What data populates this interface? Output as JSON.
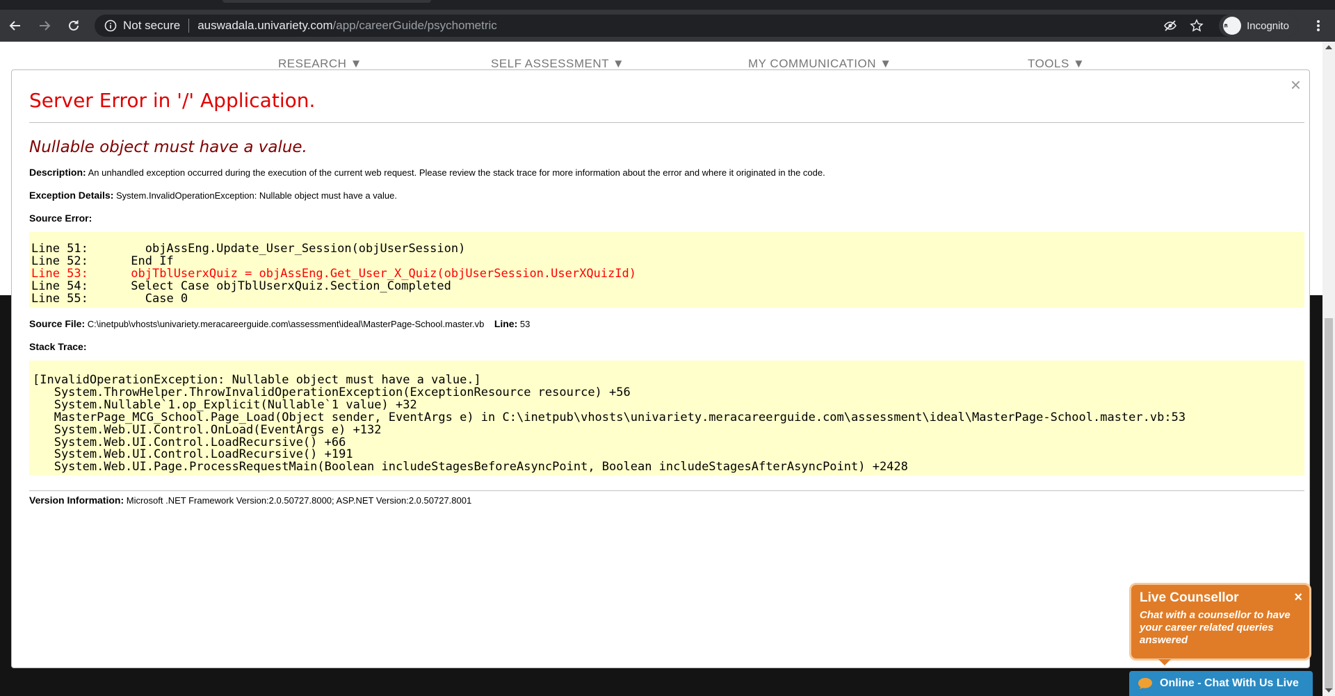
{
  "browser": {
    "security_label": "Not secure",
    "url_host": "auswadala.univariety.com",
    "url_path": "/app/careerGuide/psychometric",
    "profile_label": "Incognito"
  },
  "site_nav": {
    "items": [
      "RESEARCH ▼",
      "SELF ASSESSMENT ▼",
      "MY COMMUNICATION ▼",
      "TOOLS ▼"
    ]
  },
  "modal": {
    "close_glyph": "×"
  },
  "error_page": {
    "title": "Server Error in '/' Application.",
    "message": "Nullable object must have a value.",
    "description_label": "Description:",
    "description_text": "An unhandled exception occurred during the execution of the current web request. Please review the stack trace for more information about the error and where it originated in the code.",
    "exception_label": "Exception Details:",
    "exception_text": "System.InvalidOperationException: Nullable object must have a value.",
    "source_error_label": "Source Error:",
    "source_lines": [
      "Line 51:        objAssEng.Update_User_Session(objUserSession)",
      "Line 52:      End If"
    ],
    "source_error_line": "Line 53:      objTblUserxQuiz = objAssEng.Get_User_X_Quiz(objUserSession.UserXQuizId)",
    "source_lines_after": [
      "Line 54:      Select Case objTblUserxQuiz.Section_Completed",
      "Line 55:        Case 0"
    ],
    "source_file_label": "Source File:",
    "source_file_text": "C:\\inetpub\\vhosts\\univariety.meracareerguide.com\\assessment\\ideal\\MasterPage-School.master.vb",
    "line_label": "Line:",
    "line_value": "53",
    "stack_trace_label": "Stack Trace:",
    "stack_trace_lines": [
      "[InvalidOperationException: Nullable object must have a value.]",
      "   System.ThrowHelper.ThrowInvalidOperationException(ExceptionResource resource) +56",
      "   System.Nullable`1.op_Explicit(Nullable`1 value) +32",
      "   MasterPage_MCG_School.Page_Load(Object sender, EventArgs e) in C:\\inetpub\\vhosts\\univariety.meracareerguide.com\\assessment\\ideal\\MasterPage-School.master.vb:53",
      "   System.Web.UI.Control.OnLoad(EventArgs e) +132",
      "   System.Web.UI.Control.LoadRecursive() +66",
      "   System.Web.UI.Control.LoadRecursive() +191",
      "   System.Web.UI.Page.ProcessRequestMain(Boolean includeStagesBeforeAsyncPoint, Boolean includeStagesAfterAsyncPoint) +2428"
    ],
    "version_label": "Version Information:",
    "version_text": "Microsoft .NET Framework Version:2.0.50727.8000; ASP.NET Version:2.0.50727.8001"
  },
  "live_counsellor": {
    "title": "Live Counsellor",
    "close_glyph": "×",
    "text": "Chat with a counsellor to have your career related queries answered",
    "chat_bar_label": "Online - Chat With Us Live"
  },
  "colors": {
    "error_title": "#e00000",
    "error_message": "#800000",
    "code_background": "#ffffcc",
    "counsellor_orange": "#e07c27",
    "chat_blue": "#2a8ac4"
  }
}
